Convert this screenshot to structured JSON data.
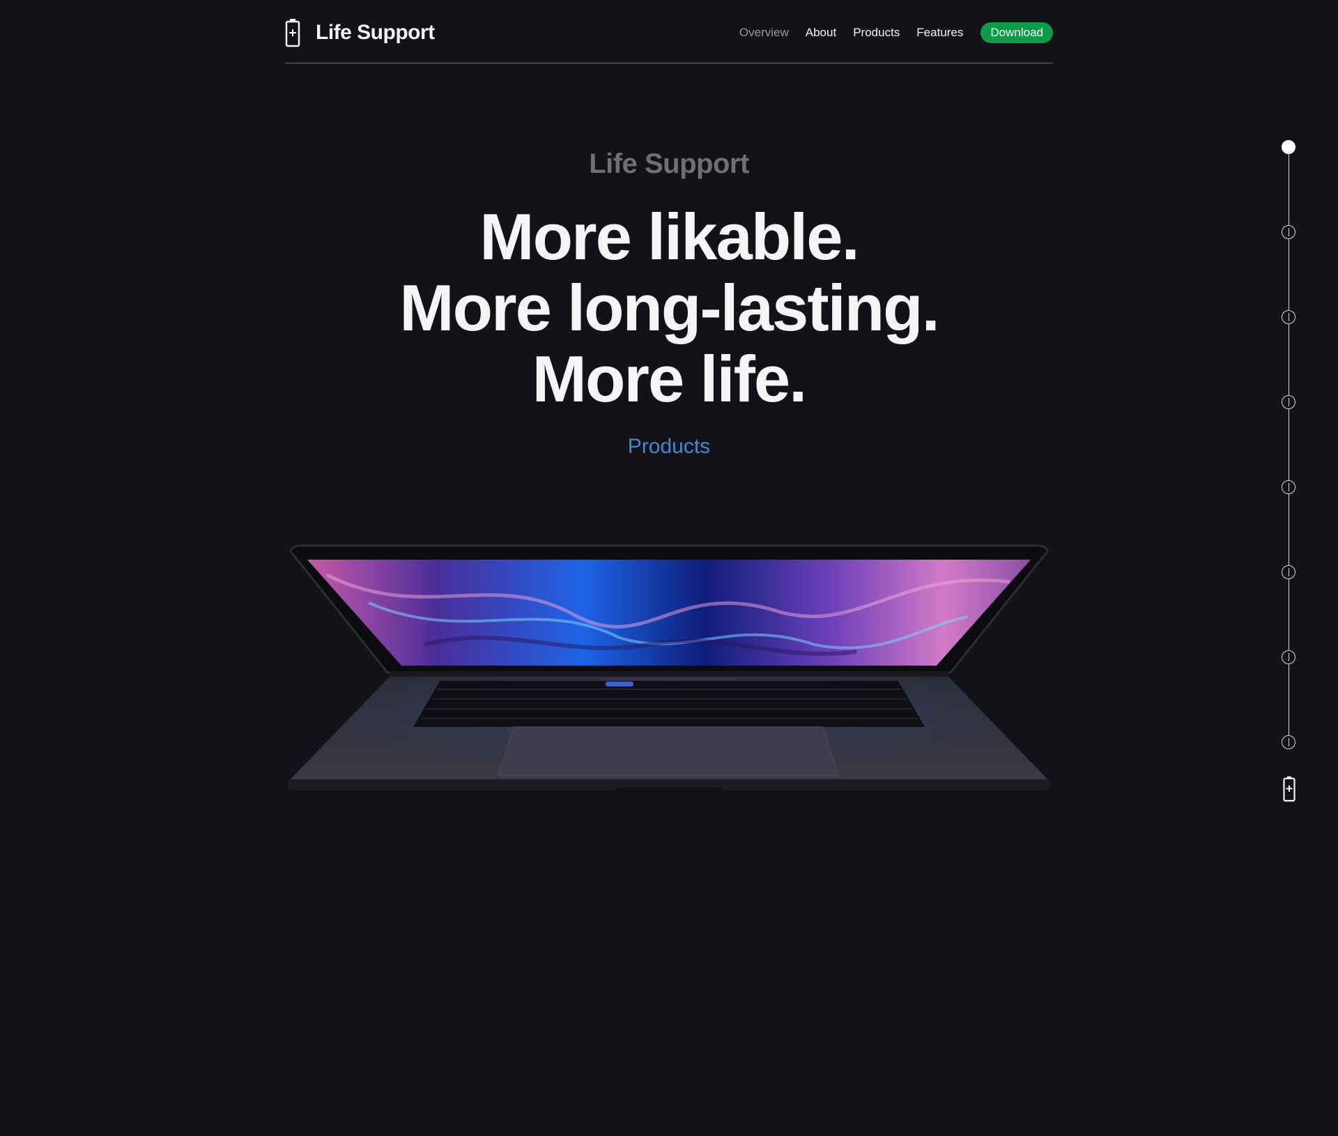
{
  "brand": {
    "name": "Life Support",
    "icon": "battery-plus-icon"
  },
  "nav": {
    "items": [
      {
        "label": "Overview",
        "state": "current"
      },
      {
        "label": "About"
      },
      {
        "label": "Products"
      },
      {
        "label": "Features"
      }
    ],
    "cta_label": "Download"
  },
  "hero": {
    "eyebrow": "Life Support",
    "headline": [
      "More likable.",
      "More long-lasting.",
      "More life."
    ],
    "link_label": "Products"
  },
  "image": {
    "subject": "laptop-open-front-view"
  },
  "section_nav": {
    "count": 8,
    "active_index": 0,
    "end_icon": "battery-plus-icon"
  },
  "colors": {
    "background": "#121217",
    "text": "#f5f5f7",
    "muted": "#6f6f76",
    "link": "#3f8ad2",
    "cta": "#0e9a48"
  }
}
